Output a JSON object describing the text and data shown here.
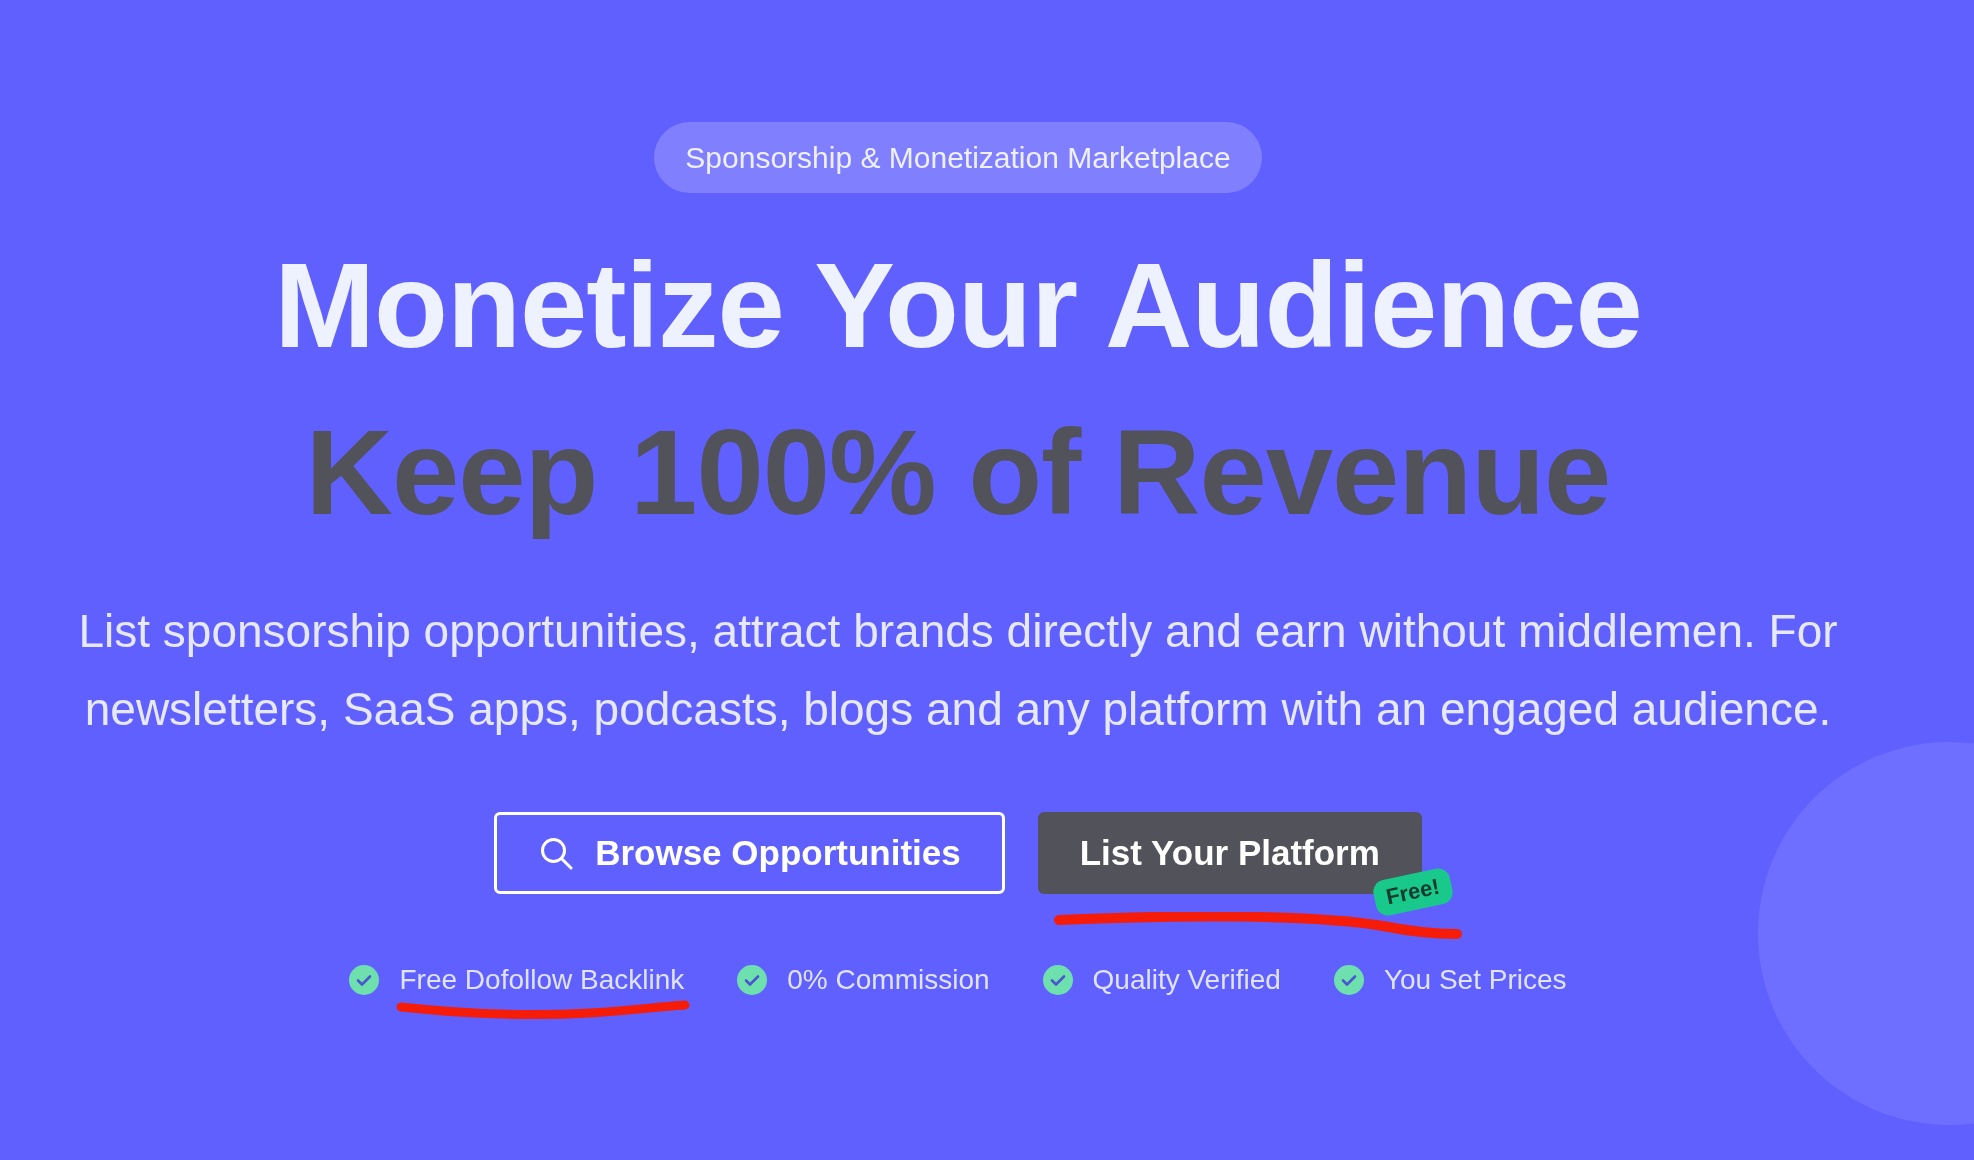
{
  "hero": {
    "eyebrow": "Sponsorship & Monetization Marketplace",
    "headline": "Monetize Your Audience",
    "subheadline": "Keep 100% of Revenue",
    "description": "List sponsorship opportunities, attract brands directly and earn without middlemen. For newsletters, SaaS apps, podcasts, blogs and any platform with an engaged audience.",
    "buttons": [
      {
        "kind": "outline",
        "label": "Browse Opportunities",
        "annotated": false
      },
      {
        "kind": "filled",
        "label": "List Your Platform",
        "badge": "Free!",
        "annotated": true
      }
    ],
    "features": [
      {
        "label": "Free Dofollow Backlink",
        "annotated": true
      },
      {
        "label": "0% Commission",
        "annotated": false
      },
      {
        "label": "Quality Verified",
        "annotated": false
      },
      {
        "label": "You Set Prices",
        "annotated": false
      }
    ]
  }
}
